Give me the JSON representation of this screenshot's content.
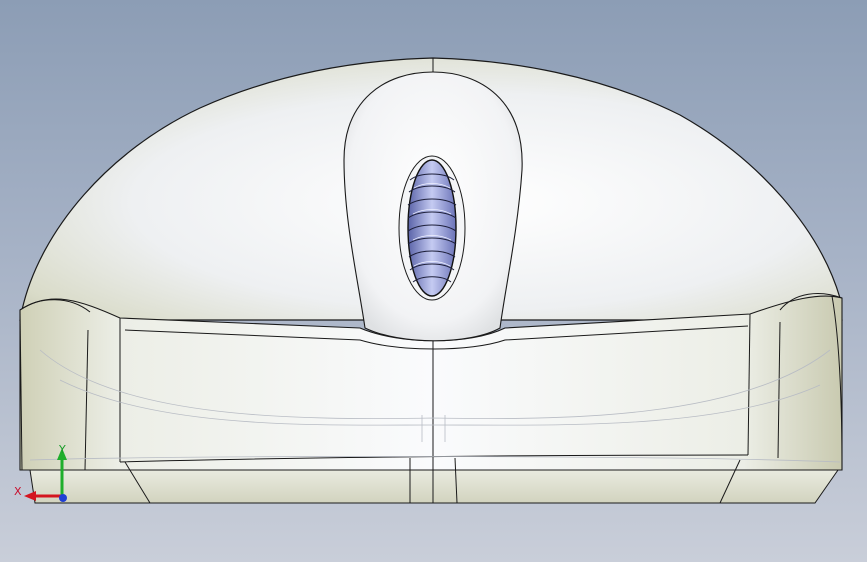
{
  "viewport": {
    "model": "mouse-shell",
    "background_top": "#8c9db5",
    "background_bottom": "#c9ced9",
    "body_color": "#f3f4f6",
    "edge_color": "#1a1a1a",
    "scroll_wheel_color": "#9ea6e0"
  },
  "triad": {
    "x_label": "X",
    "y_label": "Y",
    "x_color": "#d4151f",
    "y_color": "#1fae2c",
    "z_color": "#1f3fd4"
  }
}
